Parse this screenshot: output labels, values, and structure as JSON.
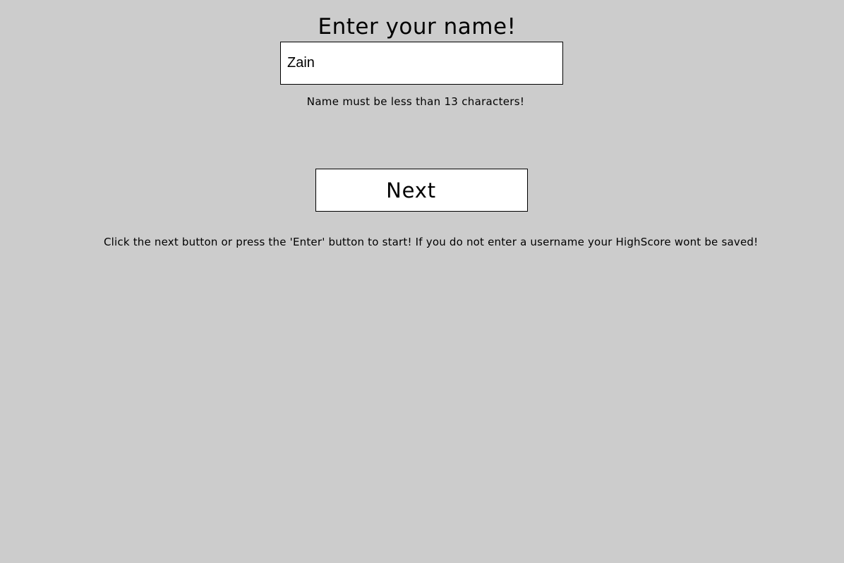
{
  "title": "Enter your name!",
  "name_input": {
    "value": "Zain",
    "placeholder": ""
  },
  "hint": "Name must be less than 13 characters!",
  "next_button": {
    "label": "Next"
  },
  "instructions": "Click the next button or press the 'Enter' button to start! If you do not enter a username your HighScore wont be saved!",
  "colors": {
    "background": "#cccccc",
    "input_background": "#ffffff",
    "border": "#000000",
    "text": "#000000"
  }
}
